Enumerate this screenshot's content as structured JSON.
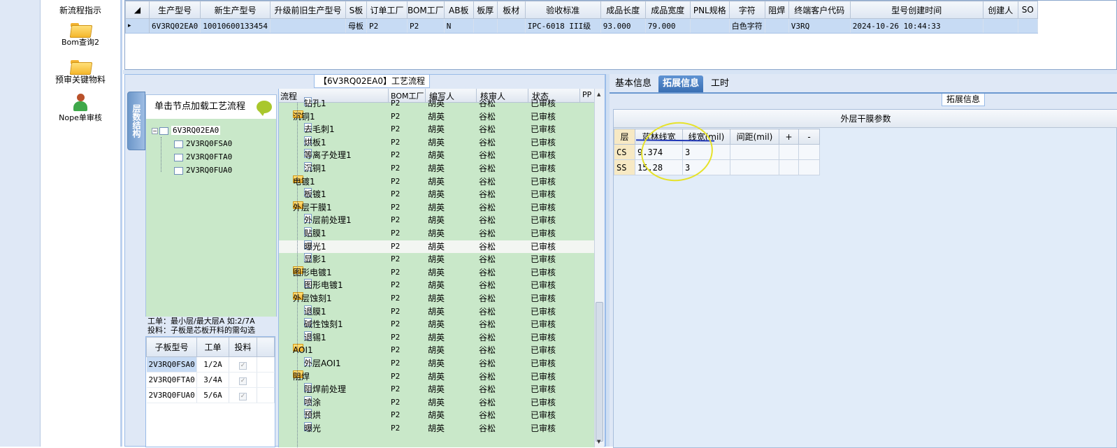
{
  "nav": {
    "items": [
      {
        "label": "新流程指示"
      },
      {
        "label": "Bom查询2"
      },
      {
        "label": "预审关键物料"
      },
      {
        "label": "Nope单审核"
      }
    ]
  },
  "top_grid": {
    "columns": [
      "生产型号",
      "新生产型号",
      "升级前旧生产型号",
      "S板",
      "订单工厂",
      "BOM工厂",
      "AB板",
      "板厚",
      "板材",
      "验收标准",
      "成品长度",
      "成品宽度",
      "PNL规格",
      "字符",
      "阻焊",
      "终端客户代码",
      "型号创建时间",
      "创建人",
      "SO"
    ],
    "row": [
      "6V3RQ02EA0",
      "10010600133454",
      "",
      "母板",
      "P2",
      "P2",
      "N",
      "",
      "",
      "IPC-6018 III级",
      "93.000",
      "79.000",
      "",
      "白色字符",
      "",
      "V3RQ",
      "2024-10-26 10:44:33",
      "",
      ""
    ]
  },
  "flow_panel": {
    "title": "【6V3RQ02EA0】工艺流程",
    "vtab_label": "层数结构",
    "hint": "单击节点加载工艺流程",
    "tree": {
      "root": "6V3RQ02EA0",
      "children": [
        "2V3RQ0FSA0",
        "2V3RQ0FTA0",
        "2V3RQ0FUA0"
      ]
    },
    "info_line1": "工单：最小层/最大层A 如:2/7A",
    "info_line2": "投料：子板是芯板开料的需勾选",
    "sub_grid": {
      "columns": [
        "子板型号",
        "工单",
        "投料"
      ],
      "rows": [
        {
          "model": "2V3RQ0FSA0",
          "order": "1/2A"
        },
        {
          "model": "2V3RQ0FTA0",
          "order": "3/4A"
        },
        {
          "model": "2V3RQ0FUA0",
          "order": "5/6A"
        }
      ]
    },
    "flow_grid": {
      "columns": [
        "流程",
        "BOM工厂",
        "编写人",
        "核审人",
        "状态",
        "PP"
      ],
      "rows": [
        {
          "level": 2,
          "name": "钻孔1",
          "factory": "P2",
          "writer": "胡英",
          "reviewer": "谷松",
          "status": "已审核"
        },
        {
          "level": 1,
          "name": "沉铜1",
          "factory": "P2",
          "writer": "胡英",
          "reviewer": "谷松",
          "status": "已审核"
        },
        {
          "level": 2,
          "name": "去毛刺1",
          "factory": "P2",
          "writer": "胡英",
          "reviewer": "谷松",
          "status": "已审核"
        },
        {
          "level": 2,
          "name": "烘板1",
          "factory": "P2",
          "writer": "胡英",
          "reviewer": "谷松",
          "status": "已审核"
        },
        {
          "level": 2,
          "name": "等离子处理1",
          "factory": "P2",
          "writer": "胡英",
          "reviewer": "谷松",
          "status": "已审核"
        },
        {
          "level": 2,
          "name": "沉铜1",
          "factory": "P2",
          "writer": "胡英",
          "reviewer": "谷松",
          "status": "已审核"
        },
        {
          "level": 1,
          "name": "电镀1",
          "factory": "P2",
          "writer": "胡英",
          "reviewer": "谷松",
          "status": "已审核"
        },
        {
          "level": 2,
          "name": "板镀1",
          "factory": "P2",
          "writer": "胡英",
          "reviewer": "谷松",
          "status": "已审核"
        },
        {
          "level": 1,
          "name": "外层干膜1",
          "factory": "P2",
          "writer": "胡英",
          "reviewer": "谷松",
          "status": "已审核"
        },
        {
          "level": 2,
          "name": "外层前处理1",
          "factory": "P2",
          "writer": "胡英",
          "reviewer": "谷松",
          "status": "已审核"
        },
        {
          "level": 2,
          "name": "贴膜1",
          "factory": "P2",
          "writer": "胡英",
          "reviewer": "谷松",
          "status": "已审核"
        },
        {
          "level": 2,
          "name": "曝光1",
          "factory": "P2",
          "writer": "胡英",
          "reviewer": "谷松",
          "status": "已审核"
        },
        {
          "level": 2,
          "name": "显影1",
          "factory": "P2",
          "writer": "胡英",
          "reviewer": "谷松",
          "status": "已审核"
        },
        {
          "level": 1,
          "name": "图形电镀1",
          "factory": "P2",
          "writer": "胡英",
          "reviewer": "谷松",
          "status": "已审核"
        },
        {
          "level": 2,
          "name": "图形电镀1",
          "factory": "P2",
          "writer": "胡英",
          "reviewer": "谷松",
          "status": "已审核"
        },
        {
          "level": 1,
          "name": "外层蚀刻1",
          "factory": "P2",
          "writer": "胡英",
          "reviewer": "谷松",
          "status": "已审核"
        },
        {
          "level": 2,
          "name": "退膜1",
          "factory": "P2",
          "writer": "胡英",
          "reviewer": "谷松",
          "status": "已审核"
        },
        {
          "level": 2,
          "name": "碱性蚀刻1",
          "factory": "P2",
          "writer": "胡英",
          "reviewer": "谷松",
          "status": "已审核"
        },
        {
          "level": 2,
          "name": "退锡1",
          "factory": "P2",
          "writer": "胡英",
          "reviewer": "谷松",
          "status": "已审核"
        },
        {
          "level": 1,
          "name": "AOI1",
          "factory": "P2",
          "writer": "胡英",
          "reviewer": "谷松",
          "status": "已审核"
        },
        {
          "level": 2,
          "name": "外层AOI1",
          "factory": "P2",
          "writer": "胡英",
          "reviewer": "谷松",
          "status": "已审核"
        },
        {
          "level": 1,
          "name": "阻焊",
          "factory": "P2",
          "writer": "胡英",
          "reviewer": "谷松",
          "status": "已审核"
        },
        {
          "level": 2,
          "name": "阻焊前处理",
          "factory": "P2",
          "writer": "胡英",
          "reviewer": "谷松",
          "status": "已审核"
        },
        {
          "level": 2,
          "name": "喷涂",
          "factory": "P2",
          "writer": "胡英",
          "reviewer": "谷松",
          "status": "已审核"
        },
        {
          "level": 2,
          "name": "预烘",
          "factory": "P2",
          "writer": "胡英",
          "reviewer": "谷松",
          "status": "已审核"
        },
        {
          "level": 2,
          "name": "曝光",
          "factory": "P2",
          "writer": "胡英",
          "reviewer": "谷松",
          "status": "已审核"
        }
      ]
    }
  },
  "right_panel": {
    "tabs": [
      "基本信息",
      "拓展信息",
      "工时"
    ],
    "active_tab": "拓展信息",
    "section_title": "拓展信息",
    "param_title": "外层干膜参数",
    "param_columns": [
      "层",
      "蓝林线宽",
      "线宽(mil)",
      "间距(mil)",
      "+",
      "-"
    ],
    "param_rows": [
      {
        "layer": "CS",
        "width": "9.374",
        "line_mil": "3"
      },
      {
        "layer": "SS",
        "width": "15.28",
        "line_mil": "3"
      }
    ]
  }
}
